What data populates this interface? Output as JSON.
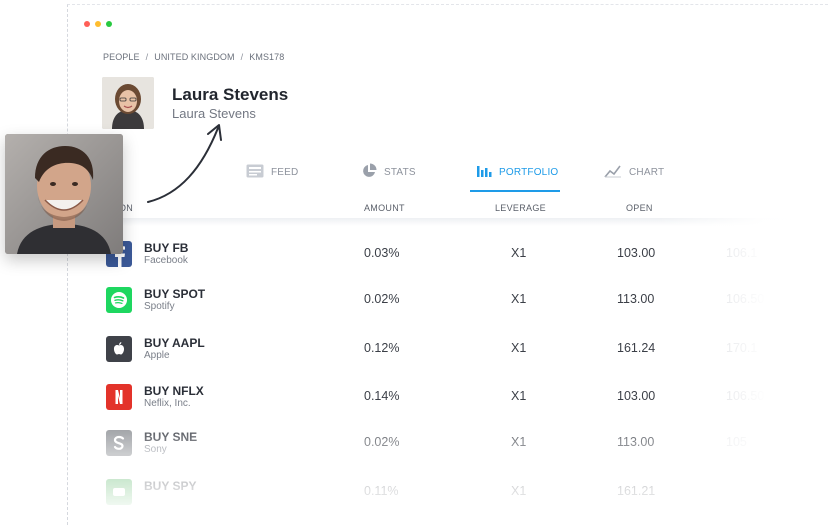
{
  "breadcrumb": {
    "items": [
      "PEOPLE",
      "UNITED KINGDOM",
      "KMS178"
    ],
    "separator": "/"
  },
  "profile": {
    "name": "Laura Stevens",
    "subtitle": "Laura Stevens"
  },
  "tabs": [
    {
      "label": "FEED",
      "icon": "feed-icon"
    },
    {
      "label": "STATS",
      "icon": "pie-chart-icon"
    },
    {
      "label": "PORTFOLIO",
      "icon": "bar-chart-icon",
      "active": true
    },
    {
      "label": "CHART",
      "icon": "line-chart-icon"
    }
  ],
  "table": {
    "headers": {
      "position": "ON",
      "amount": "AMOUNT",
      "leverage": "LEVERAGE",
      "open": "OPEN"
    },
    "rows": [
      {
        "symbol": "BUY FB",
        "company": "Facebook",
        "amount": "0.03%",
        "leverage": "X1",
        "open": "103.00",
        "current": "106.1",
        "logo": "facebook-icon",
        "color": "#3b5998"
      },
      {
        "symbol": "BUY SPOT",
        "company": "Spotify",
        "amount": "0.02%",
        "leverage": "X1",
        "open": "113.00",
        "current": "106.50",
        "logo": "spotify-icon",
        "color": "#1ed760"
      },
      {
        "symbol": "BUY AAPL",
        "company": "Apple",
        "amount": "0.12%",
        "leverage": "X1",
        "open": "161.24",
        "current": "170.1",
        "logo": "apple-icon",
        "color": "#3f4249"
      },
      {
        "symbol": "BUY NFLX",
        "company": "Neflix, Inc.",
        "amount": "0.14%",
        "leverage": "X1",
        "open": "103.00",
        "current": "106.50",
        "logo": "netflix-icon",
        "color": "#e3332a"
      },
      {
        "symbol": "BUY SNE",
        "company": "Sony",
        "amount": "0.02%",
        "leverage": "X1",
        "open": "113.00",
        "current": "105",
        "logo": "sony-icon",
        "color": "#8a8d92"
      },
      {
        "symbol": "BUY SPY",
        "company": "",
        "amount": "0.11%",
        "leverage": "X1",
        "open": "161.21",
        "current": "",
        "logo": "spy-icon",
        "color": "#3aa84a"
      }
    ]
  },
  "colors": {
    "accent": "#1e9be8",
    "dot_red": "#ff5f57",
    "dot_yellow": "#ffbd2e",
    "dot_green": "#28c940"
  }
}
